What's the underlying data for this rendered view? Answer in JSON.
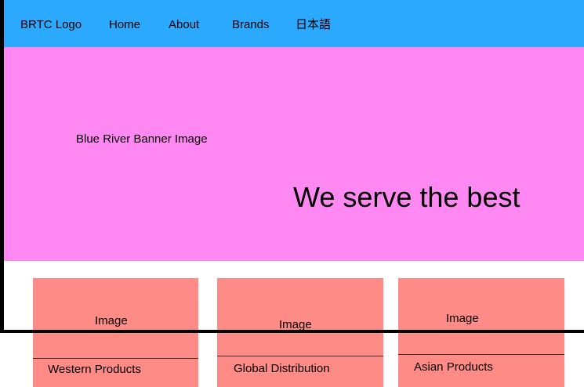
{
  "nav": {
    "logo": "BRTC Logo",
    "items": [
      "Home",
      "About",
      "Brands",
      "日本語"
    ]
  },
  "banner": {
    "image_label": "Blue River Banner Image",
    "tagline": "We serve the best"
  },
  "cards": [
    {
      "image_label": "Image",
      "title": "Western Products"
    },
    {
      "image_label": "Image",
      "title": "Global Distribution"
    },
    {
      "image_label": "Image",
      "title": "Asian Products"
    }
  ],
  "colors": {
    "nav_bg": "#2aa9ff",
    "banner_bg": "#ff88f2",
    "card_bg": "#ff8b86"
  }
}
